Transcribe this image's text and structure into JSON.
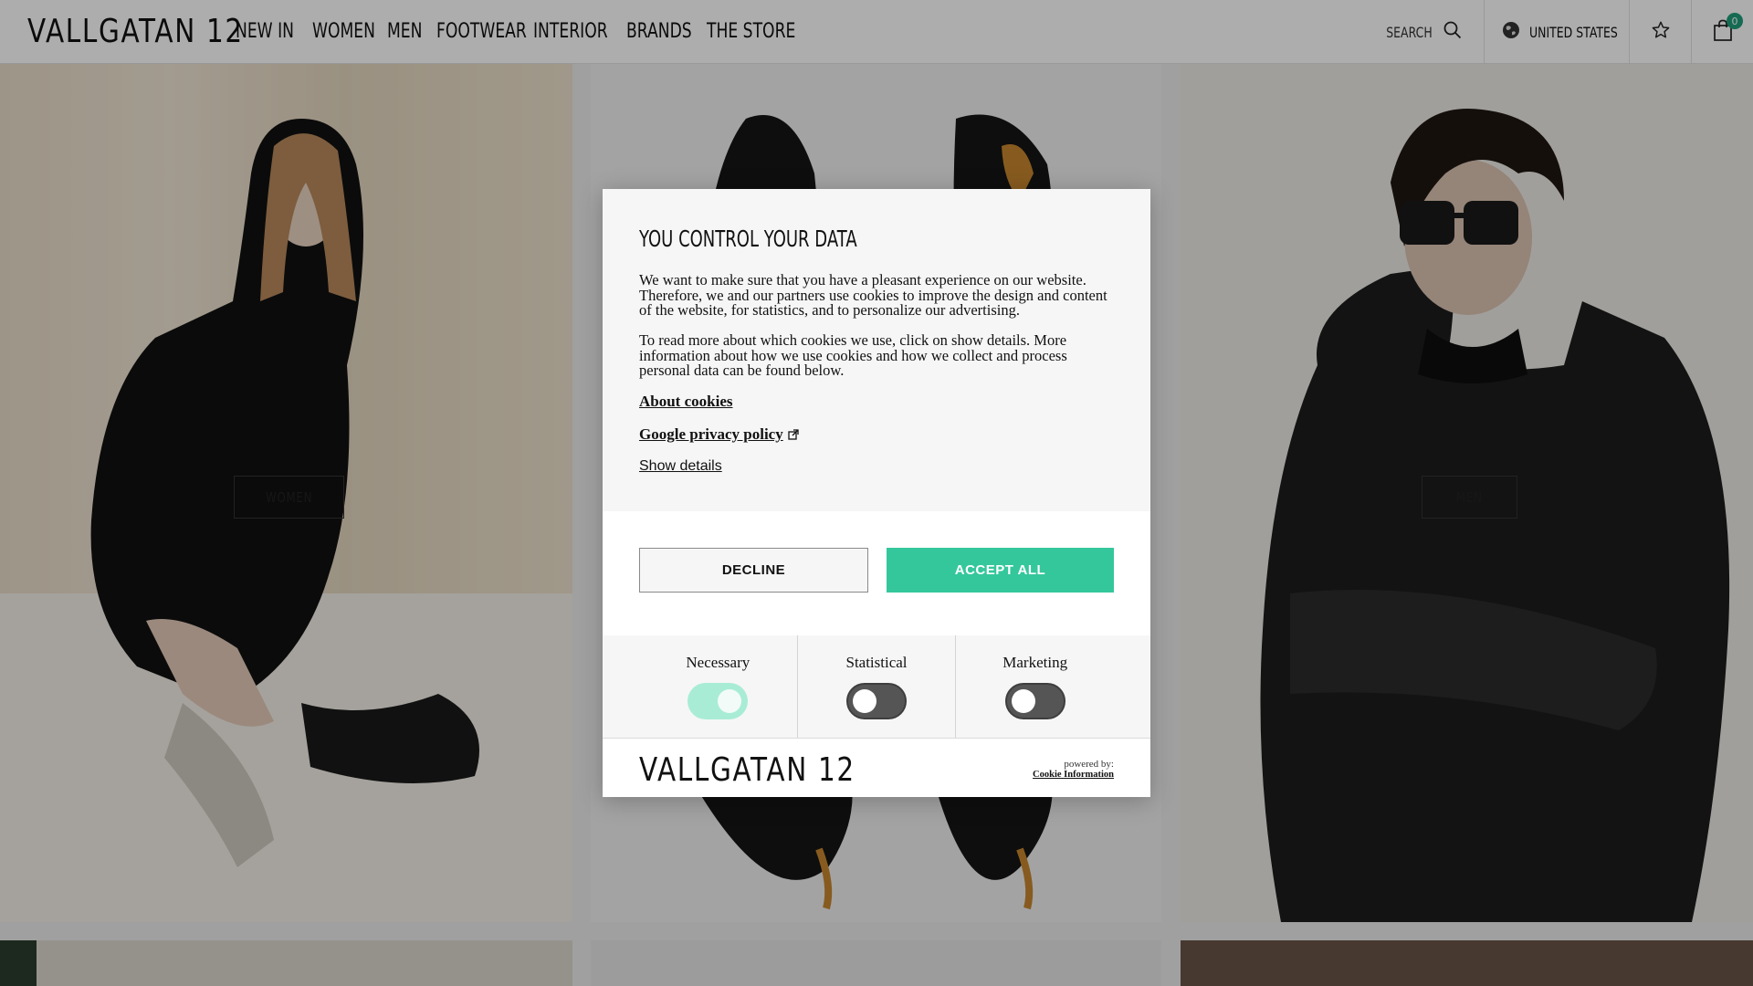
{
  "header": {
    "logo": "VALLGATAN 12",
    "nav": [
      "NEW IN",
      "WOMEN",
      "MEN",
      "FOOTWEAR",
      "INTERIOR",
      "BRANDS",
      "THE STORE"
    ],
    "search_label": "SEARCH",
    "country": "UNITED STATES",
    "cart_count": "0"
  },
  "tiles": {
    "women_label": "WOMEN",
    "men_label": "MEN"
  },
  "cookie": {
    "title": "YOU CONTROL YOUR DATA",
    "paragraph1": "We want to make sure that you have a pleasant experience on our website. Therefore, we and our partners use cookies to improve the design and content of the website, for statistics, and to personalize our advertising.",
    "paragraph2": "To read more about which cookies we use, click on show details. More information about how we use cookies and how we collect and process personal data can be found below.",
    "about_link": "About cookies",
    "google_link": "Google privacy policy",
    "show_details": "Show details",
    "decline": "DECLINE",
    "accept": "ACCEPT ALL",
    "toggles": [
      {
        "label": "Necessary",
        "on": true
      },
      {
        "label": "Statistical",
        "on": false
      },
      {
        "label": "Marketing",
        "on": false
      }
    ],
    "footer_logo": "VALLGATAN 12",
    "powered_by": "powered by:",
    "powered_name": "Cookie Information"
  },
  "colors": {
    "accent": "#35c79c",
    "toggle_on": "#a9ecd6",
    "toggle_off": "#555555",
    "badge": "#1f9e7a"
  }
}
